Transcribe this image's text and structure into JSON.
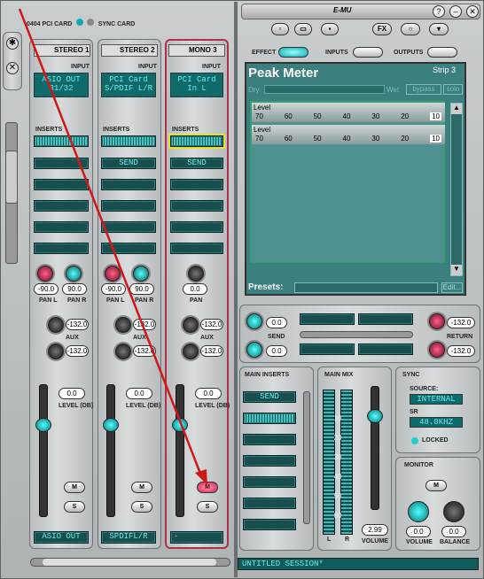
{
  "window": {
    "device": "0404 PCI CARD",
    "sync": "SYNC CARD",
    "brand": "E-MU",
    "fx": "FX",
    "status": "UNTITLED SESSION*"
  },
  "strips": [
    {
      "name": "STEREO",
      "num": "1",
      "input_label": "INPUT",
      "input": "ASIO OUT 31/32",
      "inserts": "INSERTS",
      "send": "",
      "pan_l": "-90.0",
      "pan_r": "90.0",
      "pan_l_label": "PAN L",
      "pan_r_label": "PAN R",
      "aux1": "-132.0",
      "aux2": "-132.0",
      "aux": "AUX",
      "level": "0.0",
      "level_label": "LEVEL (DB)",
      "m": "M",
      "s": "S",
      "out": "ASIO OUT"
    },
    {
      "name": "STEREO",
      "num": "2",
      "input_label": "INPUT",
      "input": "PCI Card S/PDIF L/R",
      "inserts": "INSERTS",
      "send": "SEND",
      "pan_l": "-90.0",
      "pan_r": "90.0",
      "pan_l_label": "PAN L",
      "pan_r_label": "PAN R",
      "aux1": "-132.0",
      "aux2": "-132.0",
      "aux": "AUX",
      "level": "0.0",
      "level_label": "LEVEL (DB)",
      "m": "M",
      "s": "S",
      "out": "SPDIFL/R"
    },
    {
      "name": "MONO",
      "num": "3",
      "input_label": "INPUT",
      "input": "PCI Card In L",
      "inserts": "INSERTS",
      "send": "SEND",
      "pan": "0.0",
      "pan_label": "PAN",
      "aux1": "-132.0",
      "aux2": "-132.0",
      "aux": "AUX",
      "level": "0.0",
      "level_label": "LEVEL (DB)",
      "m": "M",
      "s": "S",
      "out": "-"
    }
  ],
  "tabs": {
    "effect": "EFFECT",
    "inputs": "INPUTS",
    "outputs": "OUTPUTS"
  },
  "effect": {
    "title": "Peak Meter",
    "strip": "Strip 3",
    "dry": "Dry",
    "wet": "Wet",
    "bypass": "bypass",
    "solo": "solo",
    "level": "Level",
    "scale": [
      "70",
      "60",
      "50",
      "40",
      "30",
      "20",
      "10"
    ],
    "presets": "Presets:",
    "edit": "Edit..."
  },
  "sends": {
    "s1": "0.0",
    "s2": "0.0",
    "send": "SEND",
    "r1": "-132.0",
    "r2": "-132.0",
    "return": "RETURN"
  },
  "main_inserts": {
    "title": "MAIN INSERTS",
    "send": "SEND"
  },
  "main_mix": {
    "title": "MAIN MIX",
    "scale": [
      "10",
      "20",
      "30",
      "40",
      "50",
      "60",
      "70"
    ],
    "l": "L",
    "r": "R",
    "volume": "2.99",
    "volume_label": "VOLUME"
  },
  "sync": {
    "title": "SYNC",
    "source_label": "SOURCE:",
    "source": "INTERNAL",
    "sr_label": "SR",
    "sr": "48.0KHZ",
    "locked": "LOCKED"
  },
  "monitor": {
    "title": "MONITOR",
    "m": "M",
    "volume": "0.0",
    "balance": "0.0",
    "volume_label": "VOLUME",
    "balance_label": "BALANCE"
  }
}
